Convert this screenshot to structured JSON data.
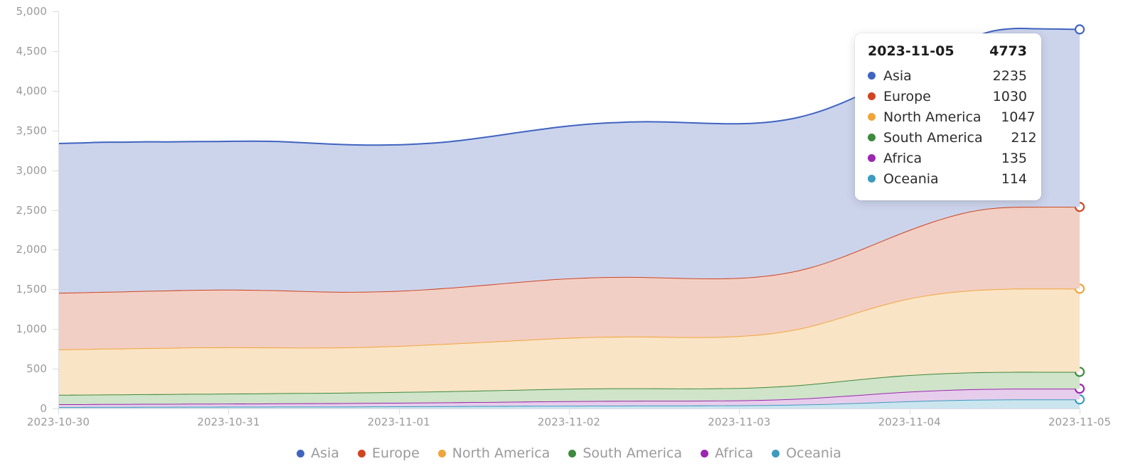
{
  "chart_data": {
    "type": "area",
    "stacked": true,
    "title": "",
    "xlabel": "",
    "ylabel": "",
    "grid": false,
    "legend_position": "bottom",
    "ylim": [
      0,
      5000
    ],
    "y_ticks": [
      "0",
      "500",
      "1,000",
      "1,500",
      "2,000",
      "2,500",
      "3,000",
      "3,500",
      "4,000",
      "4,500",
      "5,000"
    ],
    "y_tick_values": [
      0,
      500,
      1000,
      1500,
      2000,
      2500,
      3000,
      3500,
      4000,
      4500,
      5000
    ],
    "x_ticks": [
      "2023-10-30",
      "2023-10-31",
      "2023-11-01",
      "2023-11-02",
      "2023-11-03",
      "2023-11-04",
      "2023-11-05"
    ],
    "x_tick_values": [
      0,
      1,
      2,
      3,
      4,
      5,
      6
    ],
    "xlim": [
      0,
      6
    ],
    "series": [
      {
        "name": "Asia",
        "color": "#4064c0",
        "fill": "#ccd4ec",
        "values": [
          1880,
          1882,
          1884,
          1880,
          1878,
          1872,
          1868,
          1866,
          1868,
          1872,
          1874,
          1870,
          1864,
          1856,
          1848,
          1842,
          1838,
          1836,
          1840,
          1850,
          1864,
          1880,
          1896,
          1912,
          1926,
          1938,
          1948,
          1956,
          1960,
          1958,
          1952,
          1944,
          1936,
          1930,
          1928,
          1930,
          1938,
          1952,
          1974,
          2008,
          2056,
          2116,
          2180,
          2230,
          2246,
          2242,
          2238,
          2235
        ]
      },
      {
        "name": "Europe",
        "color": "#cf4520",
        "fill": "#f2cfc4",
        "values": [
          712,
          714,
          716,
          718,
          720,
          722,
          724,
          726,
          726,
          724,
          720,
          714,
          706,
          700,
          696,
          694,
          694,
          698,
          704,
          712,
          722,
          732,
          740,
          746,
          750,
          752,
          752,
          750,
          746,
          742,
          738,
          734,
          732,
          732,
          736,
          744,
          758,
          780,
          812,
          854,
          904,
          954,
          996,
          1022,
          1030,
          1030,
          1030,
          1030
        ]
      },
      {
        "name": "North America",
        "color": "#f0a53a",
        "fill": "#fae4c6",
        "values": [
          572,
          574,
          576,
          578,
          580,
          582,
          584,
          584,
          582,
          580,
          576,
          572,
          570,
          570,
          572,
          576,
          582,
          590,
          598,
          606,
          614,
          622,
          630,
          638,
          644,
          648,
          650,
          650,
          648,
          646,
          646,
          650,
          660,
          678,
          706,
          748,
          800,
          858,
          912,
          958,
          992,
          1016,
          1032,
          1042,
          1047,
          1048,
          1048,
          1047
        ]
      },
      {
        "name": "South America",
        "color": "#3e8a3e",
        "fill": "#cfe4c9",
        "values": [
          118,
          119,
          120,
          121,
          122,
          123,
          124,
          125,
          126,
          127,
          128,
          129,
          130,
          131,
          132,
          134,
          136,
          138,
          140,
          143,
          146,
          149,
          152,
          155,
          157,
          158,
          158,
          157,
          156,
          155,
          154,
          155,
          158,
          163,
          170,
          179,
          189,
          198,
          204,
          208,
          210,
          211,
          212,
          212,
          212,
          212,
          212,
          212
        ]
      },
      {
        "name": "Africa",
        "color": "#9c27b0",
        "fill": "#e7cdec",
        "values": [
          36,
          36,
          37,
          37,
          38,
          38,
          39,
          39,
          40,
          40,
          41,
          42,
          42,
          43,
          44,
          45,
          46,
          47,
          48,
          50,
          51,
          53,
          55,
          57,
          58,
          59,
          60,
          60,
          60,
          60,
          61,
          62,
          64,
          68,
          74,
          82,
          92,
          102,
          112,
          120,
          126,
          130,
          133,
          134,
          135,
          135,
          135,
          135
        ]
      },
      {
        "name": "Oceania",
        "color": "#3d9bbd",
        "fill": "#cbe5ef",
        "values": [
          18,
          18,
          19,
          19,
          20,
          20,
          21,
          21,
          22,
          22,
          23,
          23,
          24,
          24,
          25,
          26,
          27,
          28,
          29,
          30,
          31,
          32,
          33,
          34,
          35,
          36,
          36,
          37,
          37,
          37,
          38,
          39,
          41,
          44,
          48,
          54,
          62,
          70,
          80,
          89,
          97,
          104,
          109,
          112,
          114,
          114,
          114,
          114
        ]
      }
    ]
  },
  "tooltip": {
    "date": "2023-11-05",
    "total": "4773",
    "rows": [
      {
        "name": "Asia",
        "value": "2235",
        "color": "#4064c0"
      },
      {
        "name": "Europe",
        "value": "1030",
        "color": "#cf4520"
      },
      {
        "name": "North America",
        "value": "1047",
        "color": "#f0a53a"
      },
      {
        "name": "South America",
        "value": "212",
        "color": "#3e8a3e"
      },
      {
        "name": "Africa",
        "value": "135",
        "color": "#9c27b0"
      },
      {
        "name": "Oceania",
        "value": "114",
        "color": "#3d9bbd"
      }
    ]
  },
  "legend": {
    "items": [
      {
        "label": "Asia",
        "color": "#4064c0"
      },
      {
        "label": "Europe",
        "color": "#cf4520"
      },
      {
        "label": "North America",
        "color": "#f0a53a"
      },
      {
        "label": "South America",
        "color": "#3e8a3e"
      },
      {
        "label": "Africa",
        "color": "#9c27b0"
      },
      {
        "label": "Oceania",
        "color": "#3d9bbd"
      }
    ]
  }
}
